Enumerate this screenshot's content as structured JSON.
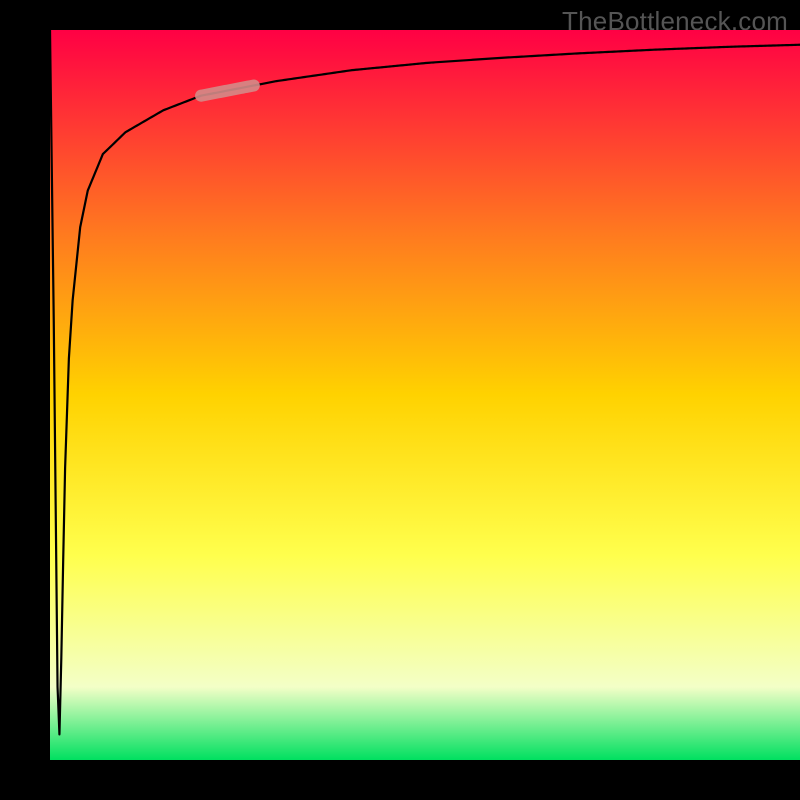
{
  "watermark": "TheBottleneck.com",
  "chart_data": {
    "type": "line",
    "title": "",
    "xlabel": "",
    "ylabel": "",
    "xlim": [
      0,
      100
    ],
    "ylim": [
      0,
      100
    ],
    "grid": false,
    "series": [
      {
        "name": "curve",
        "x": [
          0,
          0.5,
          0.8,
          1.0,
          1.2,
          1.4,
          1.6,
          2.0,
          2.5,
          3.0,
          4.0,
          5.0,
          7.0,
          10.0,
          15.0,
          20.0,
          30.0,
          40.0,
          50.0,
          60.0,
          70.0,
          80.0,
          90.0,
          100.0
        ],
        "y": [
          100,
          60,
          30,
          10,
          2,
          8,
          20,
          40,
          55,
          63,
          73,
          78,
          83,
          86,
          89,
          91,
          93,
          94.5,
          95.5,
          96.2,
          96.8,
          97.3,
          97.7,
          98
        ]
      }
    ],
    "highlight_segment": {
      "x_from": 20,
      "x_to": 27,
      "color": "#d48b88"
    },
    "background_gradient": {
      "top": "#ff0044",
      "mid_top": "#ff7a1f",
      "mid": "#ffd200",
      "mid_bottom": "#ffff4d",
      "bottom_pale": "#f3ffc7",
      "bottom": "#00e060"
    }
  }
}
